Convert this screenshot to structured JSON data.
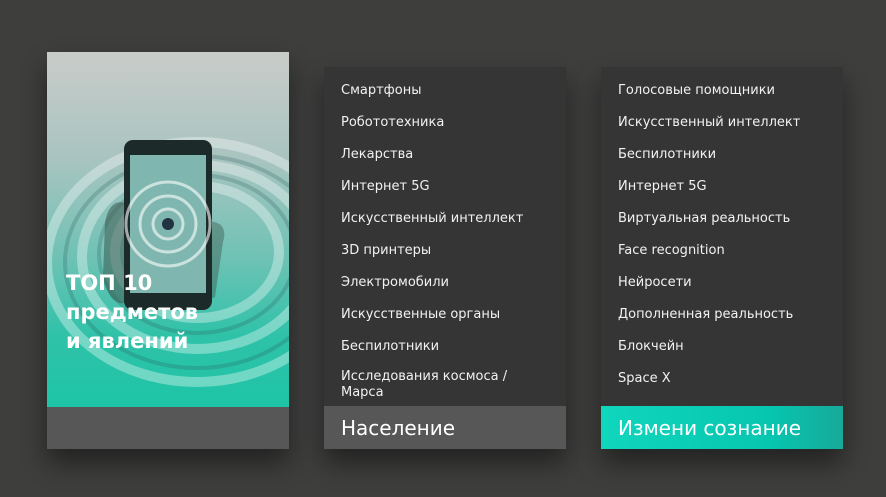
{
  "hero": {
    "title_line1": "ТОП 10",
    "title_line2": "предметов",
    "title_line3": "и явлений"
  },
  "population": {
    "items": [
      "Смартфоны",
      "Робототехника",
      "Лекарства",
      "Интернет 5G",
      "Искусственный интеллект",
      "3D принтеры",
      "Электромобили",
      "Искусственные органы",
      "Беспилотники",
      "Исследования космоса /Марса"
    ],
    "footer": "Население"
  },
  "mind": {
    "items": [
      "Голосовые помощники",
      "Искусственный интеллект",
      "Беспилотники",
      "Интернет 5G",
      "Виртуальная реальность",
      "Face recognition",
      "Нейросети",
      "Дополненная реальность",
      "Блокчейн",
      "Space X"
    ],
    "footer": "Измени сознание"
  },
  "colors": {
    "background": "#3e3e3d",
    "card": "#353535",
    "footer_gray": "#575757",
    "accent_teal": "#10d6bd"
  }
}
